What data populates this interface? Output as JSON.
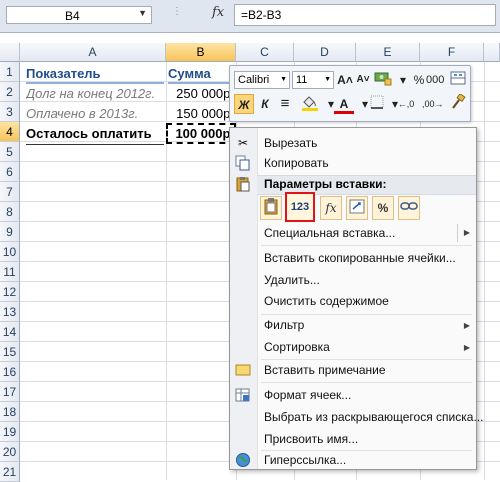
{
  "formula_bar": {
    "name_box": "B4",
    "dots": "⋮",
    "fx": "fx",
    "formula": "=B2-B3"
  },
  "columns": [
    "A",
    "B",
    "C",
    "D",
    "E",
    "F"
  ],
  "rows": [
    "1",
    "2",
    "3",
    "4",
    "5",
    "6",
    "7",
    "8",
    "9",
    "10",
    "11",
    "12",
    "13",
    "14",
    "15",
    "16",
    "17",
    "18",
    "19",
    "20",
    "21"
  ],
  "cells": {
    "a1": "Показатель",
    "b1": "Сумма",
    "a2": "Долг на конец 2012г.",
    "b2": "250 000р.",
    "a3": "Оплачено в 2013г.",
    "b3": "150 000р.",
    "a4": "Осталось оплатить",
    "b4": "100 000р."
  },
  "mini_toolbar": {
    "font_name": "Calibri",
    "font_size": "11",
    "grow_font": "A˄",
    "shrink_font": "A˅",
    "percent": "%",
    "thousands": "000",
    "bold": "Ж",
    "italic": "К",
    "align": "≡",
    "font_color": "A",
    "decimal_inc": "←,0",
    "decimal_dec": ",00→"
  },
  "context_menu": {
    "cut": "Вырезать",
    "copy": "Копировать",
    "paste_options_header": "Параметры вставки:",
    "paste_values_label": "123",
    "paste_formulas_label": "fx",
    "paste_percent_label": "%",
    "special_paste": "Специальная вставка...",
    "insert_copied": "Вставить скопированные ячейки...",
    "delete": "Удалить...",
    "clear": "Очистить содержимое",
    "filter": "Фильтр",
    "sort": "Сортировка",
    "insert_note": "Вставить примечание",
    "format_cells": "Формат ячеек...",
    "pick_list": "Выбрать из раскрывающегося списка...",
    "assign_name": "Присвоить имя...",
    "hyperlink": "Гиперссылка..."
  }
}
